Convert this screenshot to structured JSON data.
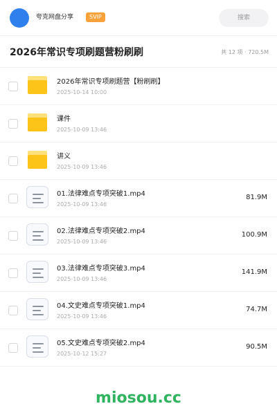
{
  "header": {
    "username": "夸克网盘分享",
    "badge": "SVIP",
    "search_placeholder": "搜索"
  },
  "folder": {
    "title": "2026年常识专项刷题营粉刷刷",
    "count": "共 12 项 · 720.5M"
  },
  "items": [
    {
      "type": "folder",
      "name": "2026年常识专项刷题营【粉刷刷】",
      "date": "2025-10-14 10:00",
      "size": ""
    },
    {
      "type": "folder",
      "name": "课件",
      "date": "2025-10-09 13:46",
      "size": ""
    },
    {
      "type": "folder",
      "name": "讲义",
      "date": "2025-10-09 13:46",
      "size": ""
    },
    {
      "type": "file",
      "name": "01.法律难点专项突破1.mp4",
      "date": "2025-10-09 13:46",
      "size": "81.9M"
    },
    {
      "type": "file",
      "name": "02.法律难点专项突破2.mp4",
      "date": "2025-10-09 13:46",
      "size": "100.9M"
    },
    {
      "type": "file",
      "name": "03.法律难点专项突破3.mp4",
      "date": "2025-10-09 13:46",
      "size": "141.9M"
    },
    {
      "type": "file",
      "name": "04.文史难点专项突破1.mp4",
      "date": "2025-10-09 13:46",
      "size": "74.7M"
    },
    {
      "type": "file",
      "name": "05.文史难点专项突破2.mp4",
      "date": "2025-10-12 15:27",
      "size": "90.5M"
    }
  ],
  "icons": {
    "folder": "folder-icon",
    "video": "video-file-icon"
  },
  "colors": {
    "avatar": "#2f80ed",
    "badge": "#f7a23a",
    "folder": "#fcc419",
    "watermark": "#2fb35f"
  },
  "footer": {
    "watermark": "miosou.cc"
  }
}
